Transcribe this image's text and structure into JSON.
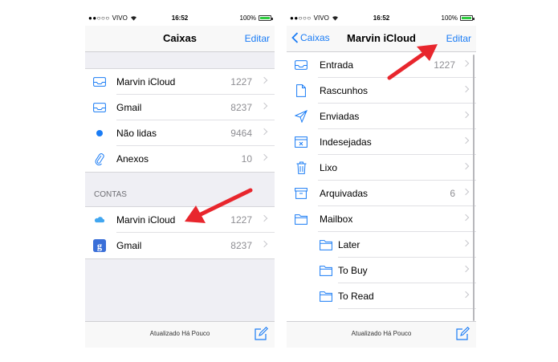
{
  "colors": {
    "accent": "#1a7cf5",
    "arrow": "#e8262d",
    "battery": "#2ecc40"
  },
  "left": {
    "status": {
      "dots": "●●○○○",
      "carrier": "VIVO",
      "time": "16:52",
      "battery": "100%"
    },
    "nav": {
      "title": "Caixas",
      "edit": "Editar"
    },
    "mailboxes": [
      {
        "icon": "inbox-icon",
        "label": "Marvin iCloud",
        "count": "1227"
      },
      {
        "icon": "inbox-icon",
        "label": "Gmail",
        "count": "8237"
      },
      {
        "icon": "unread-dot-icon",
        "label": "Não lidas",
        "count": "9464"
      },
      {
        "icon": "paperclip-icon",
        "label": "Anexos",
        "count": "10"
      }
    ],
    "accounts_header": "CONTAS",
    "accounts": [
      {
        "icon": "icloud-icon",
        "label": "Marvin iCloud",
        "count": "1227"
      },
      {
        "icon": "google-icon",
        "label": "Gmail",
        "count": "8237"
      }
    ],
    "toolbar": {
      "updated": "Atualizado Há Pouco"
    }
  },
  "right": {
    "status": {
      "dots": "●●○○○",
      "carrier": "VIVO",
      "time": "16:52",
      "battery": "100%"
    },
    "nav": {
      "back": "Caixas",
      "title": "Marvin iCloud",
      "edit": "Editar"
    },
    "folders": [
      {
        "icon": "inbox-icon",
        "label": "Entrada",
        "count": "1227"
      },
      {
        "icon": "draft-icon",
        "label": "Rascunhos",
        "count": ""
      },
      {
        "icon": "sent-icon",
        "label": "Enviadas",
        "count": ""
      },
      {
        "icon": "junk-icon",
        "label": "Indesejadas",
        "count": ""
      },
      {
        "icon": "trash-icon",
        "label": "Lixo",
        "count": ""
      },
      {
        "icon": "archive-icon",
        "label": "Arquivadas",
        "count": "6"
      },
      {
        "icon": "folder-icon",
        "label": "Mailbox",
        "count": ""
      }
    ],
    "subfolders": [
      {
        "icon": "folder-icon",
        "label": "Later"
      },
      {
        "icon": "folder-icon",
        "label": "To Buy"
      },
      {
        "icon": "folder-icon",
        "label": "To Read"
      }
    ],
    "toolbar": {
      "updated": "Atualizado Há Pouco"
    }
  }
}
